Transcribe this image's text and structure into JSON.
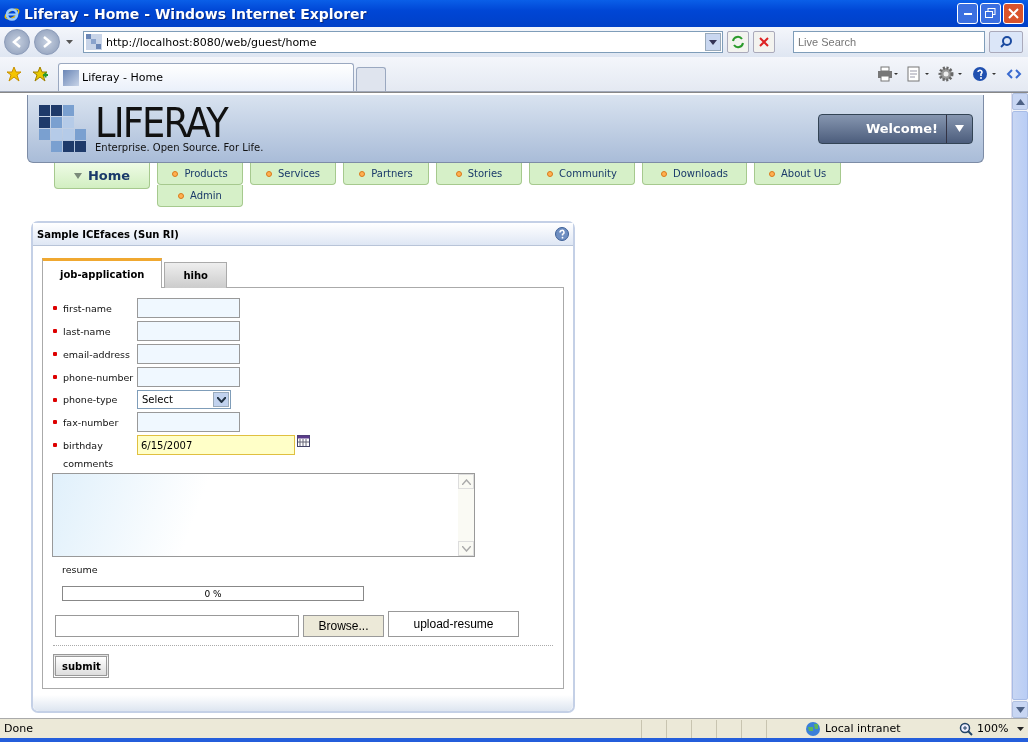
{
  "window": {
    "title": "Liferay - Home - Windows Internet Explorer"
  },
  "address_bar": {
    "url": "http://localhost:8080/web/guest/home"
  },
  "search": {
    "placeholder": "Live Search"
  },
  "browser_tabs": [
    {
      "label": "Liferay - Home",
      "selected": true
    }
  ],
  "header": {
    "logo_text": "LIFERAY",
    "tagline": "Enterprise. Open Source. For Life.",
    "welcome_button": "Welcome!"
  },
  "nav": [
    {
      "label": "Home",
      "selected": true
    },
    {
      "label": "Products",
      "selected": false,
      "children": [
        {
          "label": "Admin",
          "selected": false
        }
      ]
    },
    {
      "label": "Services",
      "selected": false
    },
    {
      "label": "Partners",
      "selected": false
    },
    {
      "label": "Stories",
      "selected": false
    },
    {
      "label": "Community",
      "selected": false
    },
    {
      "label": "Downloads",
      "selected": false
    },
    {
      "label": "About Us",
      "selected": false
    }
  ],
  "portlet": {
    "title": "Sample ICEfaces (Sun RI)",
    "tabs": [
      {
        "label": "job-application",
        "selected": true
      },
      {
        "label": "hiho",
        "selected": false
      }
    ],
    "fields": [
      {
        "kind": "text",
        "label": "first-name",
        "required": true
      },
      {
        "kind": "text",
        "label": "last-name",
        "required": true
      },
      {
        "kind": "text",
        "label": "email-address",
        "required": true
      },
      {
        "kind": "text",
        "label": "phone-number",
        "required": true
      },
      {
        "kind": "select",
        "label": "phone-type",
        "required": true,
        "value": "Select"
      },
      {
        "kind": "text",
        "label": "fax-number",
        "required": true
      },
      {
        "kind": "date",
        "label": "birthday",
        "required": true,
        "value": "6/15/2007"
      },
      {
        "kind": "textarea",
        "label": "comments"
      }
    ],
    "resume_label": "resume",
    "progress": {
      "level": 0,
      "reading": "0 %"
    },
    "browse_button": "Browse...",
    "upload_button": "upload-resume",
    "submit_button": "submit"
  },
  "status_bar": {
    "text": "Done",
    "zone": "Local intranet",
    "zoom": "100%"
  }
}
